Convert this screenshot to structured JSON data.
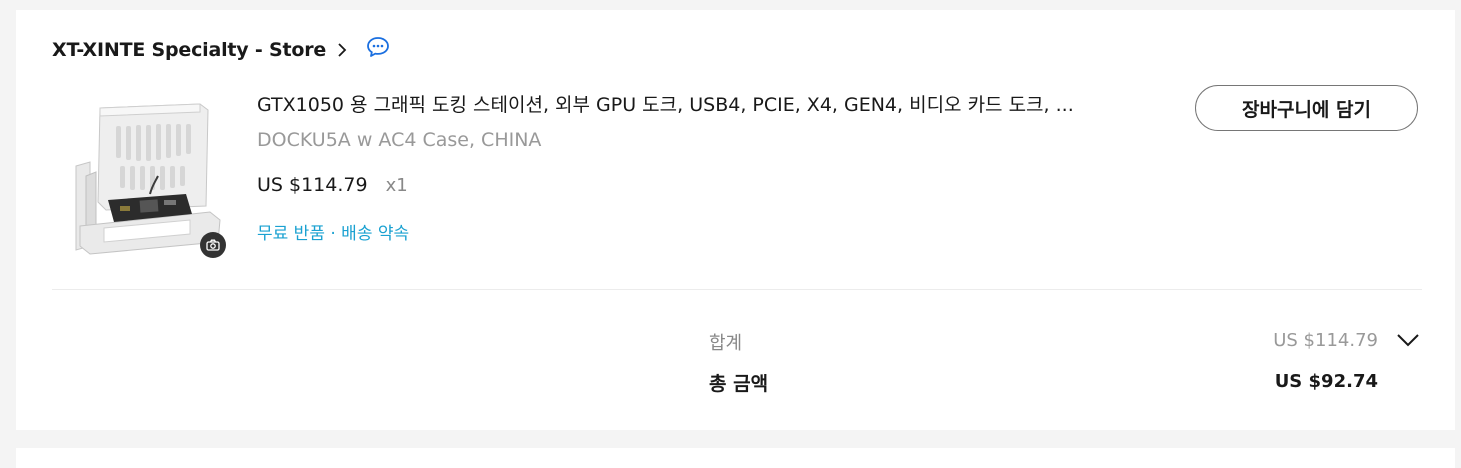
{
  "store": {
    "name": "XT-XINTE Specialty - Store",
    "chevron_icon": "chevron-right-icon",
    "chat_icon": "chat-bubble-icon",
    "chat_color": "#1a6fe0"
  },
  "item": {
    "title": "GTX1050 용 그래픽 도킹 스테이션, 외부 GPU 도크, USB4, PCIE, X4, GEN4, 비디오 카드 도크, ...",
    "variant": "DOCKU5A w AC4 Case, CHINA",
    "price": "US $114.79",
    "quantity": "x1",
    "shipping": "무료 반품 · 배송 약속",
    "shipping_color": "#1aa1d1",
    "camera_icon": "camera-icon"
  },
  "actions": {
    "add_to_cart": "장바구니에 담기"
  },
  "summary": {
    "subtotal_label": "합계",
    "subtotal_value": "US $114.79",
    "toggle_icon": "chevron-down-icon",
    "total_label": "총 금액",
    "total_value": "US $92.74"
  }
}
